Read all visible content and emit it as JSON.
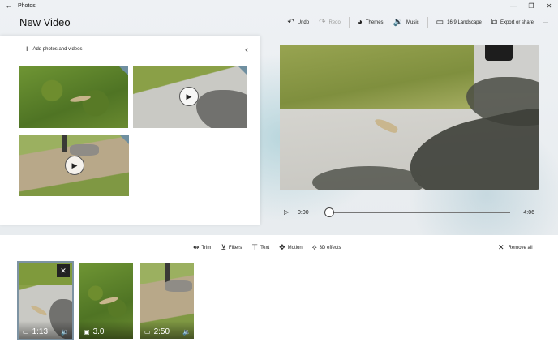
{
  "app": {
    "title": "Photos"
  },
  "header": {
    "title": "New Video"
  },
  "toolbar": {
    "undo": "Undo",
    "redo": "Redo",
    "themes": "Themes",
    "music": "Music",
    "aspect": "16:9 Landscape",
    "export": "Export or share",
    "more": "···"
  },
  "library": {
    "add_label": "Add photos and videos"
  },
  "playback": {
    "current_time": "0:00",
    "duration": "4:06",
    "progress": 0
  },
  "storyboard": {
    "tools": {
      "trim": "Trim",
      "filters": "Filters",
      "text": "Text",
      "motion": "Motion",
      "effects3d": "3D effects"
    },
    "remove_all": "Remove all",
    "cards": [
      {
        "duration": "1:13",
        "kind": "video",
        "selected": true
      },
      {
        "duration": "3.0",
        "kind": "photo",
        "selected": false
      },
      {
        "duration": "2:50",
        "kind": "video",
        "selected": false
      }
    ]
  },
  "icons": {
    "back": "back-arrow-icon",
    "undo": "undo-icon",
    "redo": "redo-icon",
    "themes": "palette-icon",
    "music": "music-icon",
    "aspect": "aspect-ratio-icon",
    "export": "export-icon",
    "more": "more-icon",
    "add": "plus-icon",
    "collapse": "chevron-left-icon",
    "play": "play-icon",
    "trim": "trim-icon",
    "filters": "filters-icon",
    "text": "text-icon",
    "motion": "motion-icon",
    "effects3d": "3d-effects-icon",
    "remove_all": "close-icon"
  }
}
